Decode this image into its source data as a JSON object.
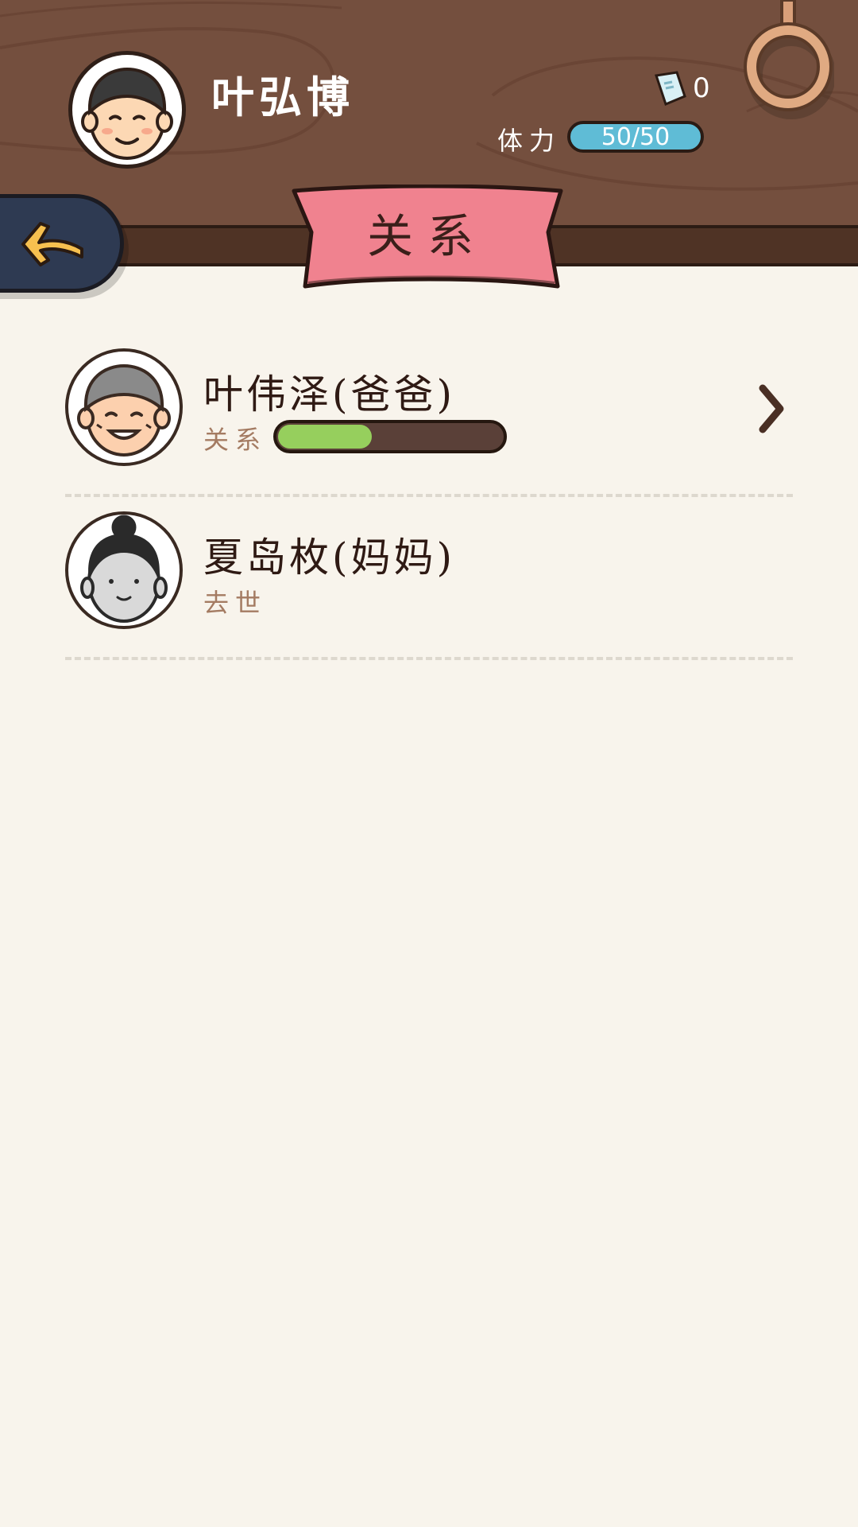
{
  "header": {
    "player_name": "叶弘博",
    "currency_value": "0",
    "currency_icon": "money-note-icon",
    "stamina_label": "体力",
    "stamina_value": "50/50",
    "settings_icon": "ring-icon",
    "back_icon": "back-arrow-icon",
    "page_title": "关系"
  },
  "colors": {
    "header_wood": "#744f3e",
    "banner_pink": "#f0828f",
    "stamina_blue": "#5fbcd6",
    "relation_green": "#96cf5d",
    "page_bg": "#f8f4ec"
  },
  "relations": [
    {
      "name": "叶伟泽(爸爸)",
      "status_label": "关系",
      "relation_level": 0.42,
      "avatar_icon": "grandpa-face-icon",
      "has_detail": true
    },
    {
      "name": "夏岛枚(妈妈)",
      "status_label": "去世",
      "avatar_icon": "mother-face-icon",
      "has_detail": false
    }
  ]
}
